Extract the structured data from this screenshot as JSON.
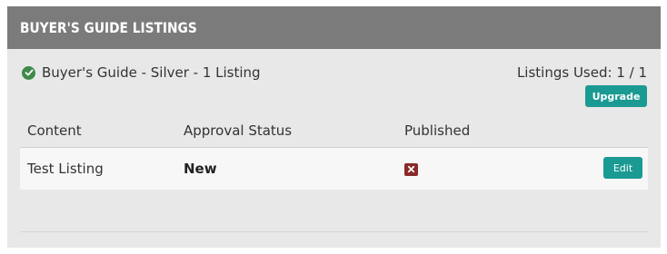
{
  "panel": {
    "title": "BUYER'S GUIDE LISTINGS"
  },
  "plan": {
    "name": "Buyer's Guide - Silver - 1 Listing",
    "status_icon": "check-circle-icon",
    "listings_used": "Listings Used: 1 / 1",
    "upgrade_label": "Upgrade"
  },
  "table": {
    "headers": {
      "content": "Content",
      "status": "Approval Status",
      "published": "Published"
    },
    "rows": [
      {
        "content": "Test Listing",
        "status": "New",
        "published_icon": "x-icon",
        "edit_label": "Edit"
      }
    ]
  },
  "colors": {
    "header_bg": "#7b7b7b",
    "panel_bg": "#e8e8e8",
    "accent": "#1a9a93",
    "success": "#3f8a4a",
    "danger": "#8b2a2a"
  }
}
